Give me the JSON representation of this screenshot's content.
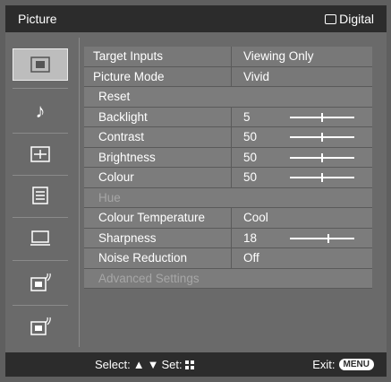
{
  "header": {
    "title": "Picture",
    "source": "Digital"
  },
  "sidebar": {
    "items": [
      {
        "name": "picture",
        "icon": "picture-icon",
        "active": true
      },
      {
        "name": "sound",
        "icon": "music-note-icon",
        "active": false
      },
      {
        "name": "screen",
        "icon": "screen-format-icon",
        "active": false
      },
      {
        "name": "features",
        "icon": "list-settings-icon",
        "active": false
      },
      {
        "name": "pc",
        "icon": "monitor-icon",
        "active": false
      },
      {
        "name": "analogue-setup",
        "icon": "analogue-setup-icon",
        "active": false
      },
      {
        "name": "digital-setup",
        "icon": "digital-setup-icon",
        "active": false
      }
    ]
  },
  "menu": {
    "target_inputs": {
      "label": "Target Inputs",
      "value": "Viewing Only"
    },
    "picture_mode": {
      "label": "Picture Mode",
      "value": "Vivid"
    },
    "reset": {
      "label": "Reset"
    },
    "backlight": {
      "label": "Backlight",
      "value": "5",
      "level": 0.5
    },
    "contrast": {
      "label": "Contrast",
      "value": "50",
      "level": 0.5
    },
    "brightness": {
      "label": "Brightness",
      "value": "50",
      "level": 0.5
    },
    "colour": {
      "label": "Colour",
      "value": "50",
      "level": 0.5
    },
    "hue": {
      "label": "Hue"
    },
    "colour_temperature": {
      "label": "Colour Temperature",
      "value": "Cool"
    },
    "sharpness": {
      "label": "Sharpness",
      "value": "18",
      "level": 0.6
    },
    "noise_reduction": {
      "label": "Noise Reduction",
      "value": "Off"
    },
    "advanced_settings": {
      "label": "Advanced Settings"
    }
  },
  "footer": {
    "select_label": "Select:",
    "set_label": "Set:",
    "exit_label": "Exit:",
    "menu_button": "MENU"
  },
  "colors": {
    "background": "#5f5f5f",
    "bar": "#2c2c2c",
    "row": "#7c7c7c",
    "disabled_text": "#a6a6a6"
  }
}
